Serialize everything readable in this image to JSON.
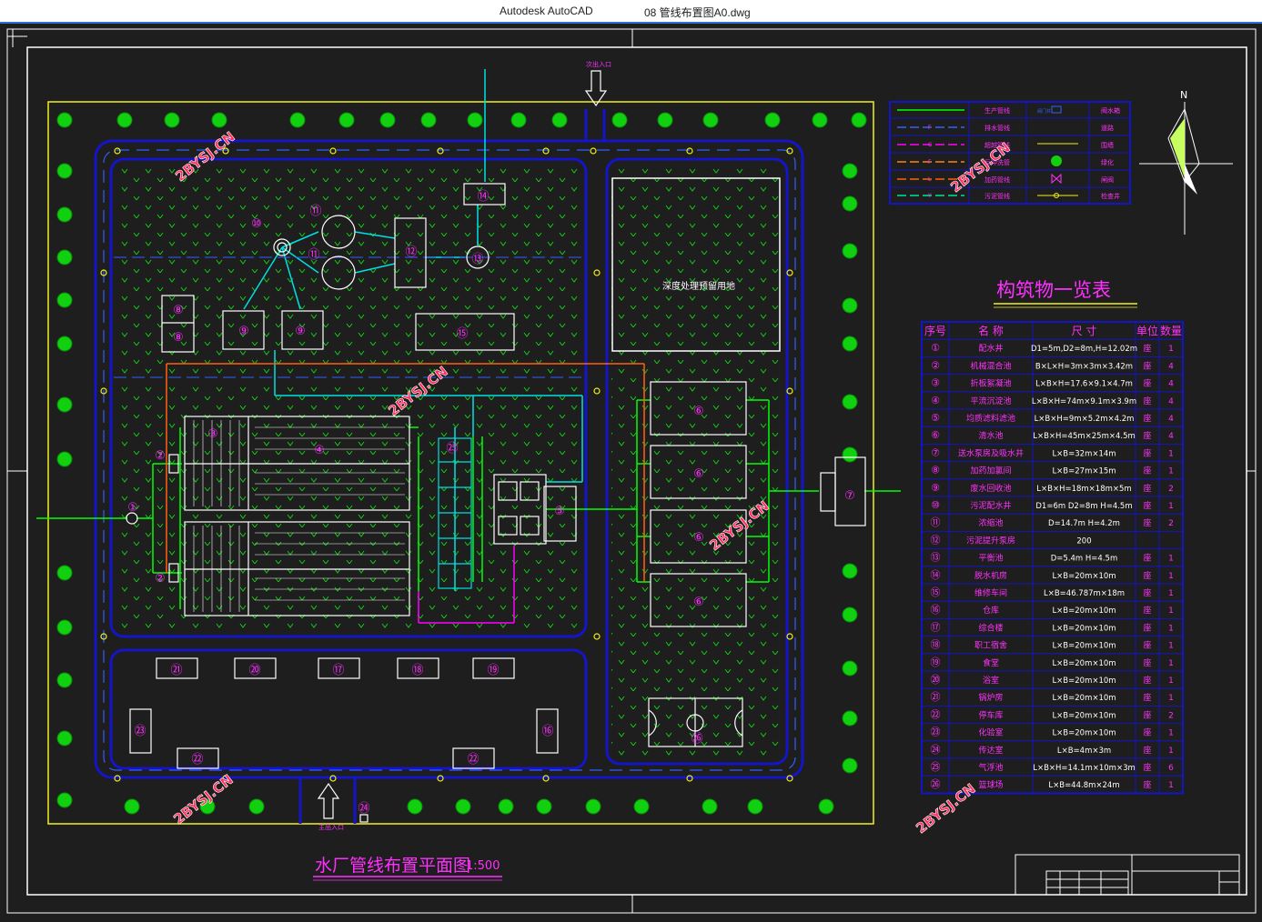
{
  "window": {
    "app_name": "Autodesk AutoCAD",
    "file_name": "08 管线布置图A0.dwg"
  },
  "watermark": "2BYSJ.CN",
  "colors": {
    "background": "#1e1e1e",
    "frame": "#ffffff",
    "site_border": "#f0f020",
    "road": "#1414c8",
    "water_pipe": "#00ff00",
    "cyan_pipe": "#00e0e0",
    "orange_pipe": "#ff6010",
    "magenta_pipe": "#ff00ff",
    "label_magenta": "#ff30ff",
    "tree": "#10d010"
  },
  "drawing": {
    "title": "水厂管线布置平面图",
    "scale": "1:500",
    "north_label": "N",
    "entrance_top": "次出入口",
    "entrance_bottom": "主出入口",
    "reserved_area_label": "深度处理预留用地"
  },
  "legend": {
    "rows": [
      {
        "code": "",
        "pipe": "生产管线",
        "symbol": "阀门井",
        "symbol_name": "阀水箱"
      },
      {
        "code": "F",
        "pipe": "排水管线",
        "symbol": "",
        "symbol_name": "道路"
      },
      {
        "code": "C",
        "pipe": "超越管线",
        "symbol": "",
        "symbol_name": "围墙"
      },
      {
        "code": "F",
        "pipe": "反冲洗管",
        "symbol": "",
        "symbol_name": "绿化"
      },
      {
        "code": "L",
        "pipe": "加药管线",
        "symbol": "",
        "symbol_name": "闸阀"
      },
      {
        "code": "Y",
        "pipe": "污泥管线",
        "symbol": "",
        "symbol_name": "检查井"
      }
    ]
  },
  "structures_table": {
    "title": "构筑物一览表",
    "headers": [
      "序号",
      "名  称",
      "尺  寸",
      "单位",
      "数量"
    ],
    "rows": [
      {
        "no": "①",
        "name": "配水井",
        "size": "D1=5m,D2=8m,H=12.02m",
        "unit": "座",
        "qty": "1"
      },
      {
        "no": "②",
        "name": "机械混合池",
        "size": "B×L×H=3m×3m×3.42m",
        "unit": "座",
        "qty": "4"
      },
      {
        "no": "③",
        "name": "折板絮凝池",
        "size": "L×B×H=17.6×9.1×4.7m",
        "unit": "座",
        "qty": "4"
      },
      {
        "no": "④",
        "name": "平流沉淀池",
        "size": "L×B×H=74m×9.1m×3.9m",
        "unit": "座",
        "qty": "4"
      },
      {
        "no": "⑤",
        "name": "均质滤料滤池",
        "size": "L×B×H=9m×5.2m×4.2m",
        "unit": "座",
        "qty": "4"
      },
      {
        "no": "⑥",
        "name": "清水池",
        "size": "L×B×H=45m×25m×4.5m",
        "unit": "座",
        "qty": "4"
      },
      {
        "no": "⑦",
        "name": "送水泵房及吸水井",
        "size": "L×B=32m×14m",
        "unit": "座",
        "qty": "1"
      },
      {
        "no": "⑧",
        "name": "加药加氯间",
        "size": "L×B=27m×15m",
        "unit": "座",
        "qty": "1"
      },
      {
        "no": "⑨",
        "name": "废水回收池",
        "size": "L×B×H=18m×18m×5m",
        "unit": "座",
        "qty": "2"
      },
      {
        "no": "⑩",
        "name": "污泥配水井",
        "size": "D1=6m D2=8m H=4.5m",
        "unit": "座",
        "qty": "1"
      },
      {
        "no": "⑪",
        "name": "浓缩池",
        "size": "D=14.7m  H=4.2m",
        "unit": "座",
        "qty": "2"
      },
      {
        "no": "⑫",
        "name": "污泥提升泵房",
        "size": "200",
        "unit": "",
        "qty": ""
      },
      {
        "no": "⑬",
        "name": "平衡池",
        "size": "D=5.4m  H=4.5m",
        "unit": "座",
        "qty": "1"
      },
      {
        "no": "⑭",
        "name": "脱水机房",
        "size": "L×B=20m×10m",
        "unit": "座",
        "qty": "1"
      },
      {
        "no": "⑮",
        "name": "维修车间",
        "size": "L×B=46.787m×18m",
        "unit": "座",
        "qty": "1"
      },
      {
        "no": "⑯",
        "name": "仓库",
        "size": "L×B=20m×10m",
        "unit": "座",
        "qty": "1"
      },
      {
        "no": "⑰",
        "name": "综合楼",
        "size": "L×B=20m×10m",
        "unit": "座",
        "qty": "1"
      },
      {
        "no": "⑱",
        "name": "职工宿舍",
        "size": "L×B=20m×10m",
        "unit": "座",
        "qty": "1"
      },
      {
        "no": "⑲",
        "name": "食堂",
        "size": "L×B=20m×10m",
        "unit": "座",
        "qty": "1"
      },
      {
        "no": "⑳",
        "name": "浴室",
        "size": "L×B=20m×10m",
        "unit": "座",
        "qty": "1"
      },
      {
        "no": "㉑",
        "name": "锅炉房",
        "size": "L×B=20m×10m",
        "unit": "座",
        "qty": "1"
      },
      {
        "no": "㉒",
        "name": "停车库",
        "size": "L×B=20m×10m",
        "unit": "座",
        "qty": "2"
      },
      {
        "no": "㉓",
        "name": "化验室",
        "size": "L×B=20m×10m",
        "unit": "座",
        "qty": "1"
      },
      {
        "no": "㉔",
        "name": "传达室",
        "size": "L×B=4m×3m",
        "unit": "座",
        "qty": "1"
      },
      {
        "no": "㉕",
        "name": "气浮池",
        "size": "L×B×H=14.1m×10m×3m",
        "unit": "座",
        "qty": "6"
      },
      {
        "no": "㉖",
        "name": "篮球场",
        "size": "L×B=44.8m×24m",
        "unit": "座",
        "qty": "1"
      }
    ]
  },
  "plan_labels": {
    "s1": "①",
    "s2": "②",
    "s3": "③",
    "s4": "④",
    "s5": "⑤",
    "s6": "⑥",
    "s7": "⑦",
    "s8": "⑧",
    "s9": "⑨",
    "s10": "⑩",
    "s11": "⑪",
    "s12": "⑫",
    "s13": "⑬",
    "s14": "⑭",
    "s15": "⑮",
    "s16": "⑯",
    "s17": "⑰",
    "s18": "⑱",
    "s19": "⑲",
    "s20": "⑳",
    "s21": "㉑",
    "s22": "㉒",
    "s23": "㉓",
    "s24": "㉔",
    "s25": "㉕",
    "s26": "㉖"
  }
}
